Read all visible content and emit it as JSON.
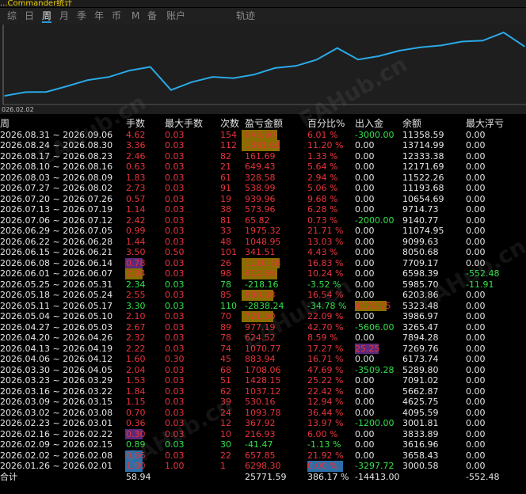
{
  "title_text": "...Commander统计",
  "tabs": [
    "综",
    "日",
    "周",
    "月",
    "季",
    "年",
    "币",
    "M",
    "备",
    "账户",
    "轨迹"
  ],
  "active_tab": "周",
  "chart": {
    "start_label": "026.02.02",
    "line_color": "#2aa9e6",
    "equity": [
      3000.58,
      3616.96,
      3658.43,
      4625.75,
      5662.87,
      6173.74,
      7269.76,
      7894.28,
      3986.97,
      5323.48,
      6203.86,
      5985.7,
      6598.39,
      7709.17,
      8050.68,
      9099.63,
      11074.95,
      9140.77,
      9714.73,
      10654.69,
      11193.68,
      11522.26,
      12171.69,
      12333.38,
      13714.99,
      11358.59
    ]
  },
  "columns": [
    "周",
    "手数",
    "最大手数",
    "次数",
    "盈亏金额",
    "百分比%",
    "出入金",
    "余额",
    "最大浮亏"
  ],
  "rows": [
    {
      "week": "2026.08.31 ~ 2026.09.06",
      "lots": "4.62",
      "maxlots": "0.03",
      "count": "154",
      "pnl": "643.60",
      "pct": "6.01 %",
      "flow": "-3000.00",
      "balance": "11358.59",
      "dd": "0.00",
      "c": "red",
      "fc": "green"
    },
    {
      "week": "2026.08.24 ~ 2026.08.30",
      "lots": "3.36",
      "maxlots": "0.03",
      "count": "112",
      "pnl": "1381.61",
      "pct": "11.20 %",
      "flow": "0.00",
      "balance": "13714.99",
      "dd": "0.00",
      "c": "red",
      "fc": "white"
    },
    {
      "week": "2026.08.17 ~ 2026.08.23",
      "lots": "2.46",
      "maxlots": "0.03",
      "count": "82",
      "pnl": "161.69",
      "pct": "1.33 %",
      "flow": "0.00",
      "balance": "12333.38",
      "dd": "0.00",
      "c": "red",
      "fc": "white"
    },
    {
      "week": "2026.08.10 ~ 2026.08.16",
      "lots": "0.63",
      "maxlots": "0.03",
      "count": "21",
      "pnl": "649.43",
      "pct": "5.64 %",
      "flow": "0.00",
      "balance": "12171.69",
      "dd": "0.00",
      "c": "red",
      "fc": "white"
    },
    {
      "week": "2026.08.03 ~ 2026.08.09",
      "lots": "1.83",
      "maxlots": "0.03",
      "count": "61",
      "pnl": "328.58",
      "pct": "2.94 %",
      "flow": "0.00",
      "balance": "11522.26",
      "dd": "0.00",
      "c": "red",
      "fc": "white"
    },
    {
      "week": "2026.07.27 ~ 2026.08.02",
      "lots": "2.73",
      "maxlots": "0.03",
      "count": "91",
      "pnl": "538.99",
      "pct": "5.06 %",
      "flow": "0.00",
      "balance": "11193.68",
      "dd": "0.00",
      "c": "red",
      "fc": "white"
    },
    {
      "week": "2026.07.20 ~ 2026.07.26",
      "lots": "0.57",
      "maxlots": "0.03",
      "count": "19",
      "pnl": "939.96",
      "pct": "9.68 %",
      "flow": "0.00",
      "balance": "10654.69",
      "dd": "0.00",
      "c": "red",
      "fc": "white"
    },
    {
      "week": "2026.07.13 ~ 2026.07.19",
      "lots": "1.14",
      "maxlots": "0.03",
      "count": "38",
      "pnl": "573.96",
      "pct": "6.28 %",
      "flow": "0.00",
      "balance": "9714.73",
      "dd": "0.00",
      "c": "red",
      "fc": "white"
    },
    {
      "week": "2026.07.06 ~ 2026.07.12",
      "lots": "2.42",
      "maxlots": "0.03",
      "count": "81",
      "pnl": "65.82",
      "pct": "0.73 %",
      "flow": "-2000.00",
      "balance": "9140.77",
      "dd": "0.00",
      "c": "red",
      "fc": "green"
    },
    {
      "week": "2026.06.29 ~ 2026.07.05",
      "lots": "0.99",
      "maxlots": "0.03",
      "count": "33",
      "pnl": "1975.32",
      "pct": "21.71 %",
      "flow": "0.00",
      "balance": "11074.95",
      "dd": "0.00",
      "c": "red",
      "fc": "white"
    },
    {
      "week": "2026.06.22 ~ 2026.06.28",
      "lots": "1.44",
      "maxlots": "0.03",
      "count": "48",
      "pnl": "1048.95",
      "pct": "13.03 %",
      "flow": "0.00",
      "balance": "9099.63",
      "dd": "0.00",
      "c": "red",
      "fc": "white"
    },
    {
      "week": "2026.06.15 ~ 2026.06.21",
      "lots": "3.50",
      "maxlots": "0.50",
      "count": "101",
      "pnl": "341.51",
      "pct": "4.43 %",
      "flow": "0.00",
      "balance": "8050.68",
      "dd": "0.00",
      "c": "red",
      "fc": "white"
    },
    {
      "week": "2026.06.08 ~ 2026.06.14",
      "lots": "0.78",
      "maxlots": "0.03",
      "count": "26",
      "pnl": "1110.78",
      "pct": "16.83 %",
      "flow": "0.00",
      "balance": "7709.17",
      "dd": "0.00",
      "c": "red",
      "fc": "white"
    },
    {
      "week": "2026.06.01 ~ 2026.06.07",
      "lots": "2.94",
      "maxlots": "0.03",
      "count": "98",
      "pnl": "612.69",
      "pct": "10.24 %",
      "flow": "0.00",
      "balance": "6598.39",
      "dd": "-552.48",
      "c": "red",
      "fc": "white",
      "ddc": "green"
    },
    {
      "week": "2026.05.25 ~ 2026.05.31",
      "lots": "2.34",
      "maxlots": "0.03",
      "count": "78",
      "pnl": "-218.16",
      "pct": "-3.52 %",
      "flow": "0.00",
      "balance": "5985.70",
      "dd": "-11.91",
      "c": "green",
      "fc": "white",
      "ddc": "green"
    },
    {
      "week": "2026.05.18 ~ 2026.05.24",
      "lots": "2.55",
      "maxlots": "0.03",
      "count": "85",
      "pnl": "880.38",
      "pct": "16.54 %",
      "flow": "0.00",
      "balance": "6203.86",
      "dd": "0.00",
      "c": "red",
      "fc": "white"
    },
    {
      "week": "2026.05.11 ~ 2026.05.17",
      "lots": "3.30",
      "maxlots": "0.03",
      "count": "110",
      "pnl": "-2838.24",
      "pct": "-34.78 %",
      "flow": "4174.75",
      "balance": "5323.48",
      "dd": "0.00",
      "c": "green",
      "fc": "red"
    },
    {
      "week": "2026.05.04 ~ 2026.05.10",
      "lots": "2.10",
      "maxlots": "0.03",
      "count": "70",
      "pnl": "721.50",
      "pct": "22.09 %",
      "flow": "0.00",
      "balance": "3986.97",
      "dd": "0.00",
      "c": "red",
      "fc": "white"
    },
    {
      "week": "2026.04.27 ~ 2026.05.03",
      "lots": "2.67",
      "maxlots": "0.03",
      "count": "89",
      "pnl": "977.19",
      "pct": "42.70 %",
      "flow": "-5606.00",
      "balance": "3265.47",
      "dd": "0.00",
      "c": "red",
      "fc": "green"
    },
    {
      "week": "2026.04.20 ~ 2026.04.26",
      "lots": "2.32",
      "maxlots": "0.03",
      "count": "78",
      "pnl": "624.52",
      "pct": "8.59 %",
      "flow": "0.00",
      "balance": "7894.28",
      "dd": "0.00",
      "c": "red",
      "fc": "white"
    },
    {
      "week": "2026.04.13 ~ 2026.04.19",
      "lots": "2.22",
      "maxlots": "0.03",
      "count": "74",
      "pnl": "1070.77",
      "pct": "17.27 %",
      "flow": "25.25",
      "balance": "7269.76",
      "dd": "0.00",
      "c": "red",
      "fc": "red"
    },
    {
      "week": "2026.04.06 ~ 2026.04.12",
      "lots": "1.60",
      "maxlots": "0.30",
      "count": "45",
      "pnl": "883.94",
      "pct": "16.71 %",
      "flow": "0.00",
      "balance": "6173.74",
      "dd": "0.00",
      "c": "red",
      "fc": "white"
    },
    {
      "week": "2026.03.30 ~ 2026.04.05",
      "lots": "2.04",
      "maxlots": "0.03",
      "count": "68",
      "pnl": "1708.06",
      "pct": "47.69 %",
      "flow": "-3509.28",
      "balance": "5289.80",
      "dd": "0.00",
      "c": "red",
      "fc": "green"
    },
    {
      "week": "2026.03.23 ~ 2026.03.29",
      "lots": "1.53",
      "maxlots": "0.03",
      "count": "51",
      "pnl": "1428.15",
      "pct": "25.22 %",
      "flow": "0.00",
      "balance": "7091.02",
      "dd": "0.00",
      "c": "red",
      "fc": "white"
    },
    {
      "week": "2026.03.16 ~ 2026.03.22",
      "lots": "1.84",
      "maxlots": "0.03",
      "count": "62",
      "pnl": "1037.12",
      "pct": "22.42 %",
      "flow": "0.00",
      "balance": "5662.87",
      "dd": "0.00",
      "c": "red",
      "fc": "white"
    },
    {
      "week": "2026.03.09 ~ 2026.03.15",
      "lots": "1.15",
      "maxlots": "0.03",
      "count": "39",
      "pnl": "530.16",
      "pct": "12.94 %",
      "flow": "0.00",
      "balance": "4625.75",
      "dd": "0.00",
      "c": "red",
      "fc": "white"
    },
    {
      "week": "2026.03.02 ~ 2026.03.08",
      "lots": "0.70",
      "maxlots": "0.03",
      "count": "24",
      "pnl": "1093.78",
      "pct": "36.44 %",
      "flow": "0.00",
      "balance": "4095.59",
      "dd": "0.00",
      "c": "red",
      "fc": "white"
    },
    {
      "week": "2026.02.23 ~ 2026.03.01",
      "lots": "0.36",
      "maxlots": "0.03",
      "count": "12",
      "pnl": "367.92",
      "pct": "13.97 %",
      "flow": "-1200.00",
      "balance": "3001.81",
      "dd": "0.00",
      "c": "red",
      "fc": "green"
    },
    {
      "week": "2026.02.16 ~ 2026.02.22",
      "lots": "0.30",
      "maxlots": "0.03",
      "count": "10",
      "pnl": "216.93",
      "pct": "6.00 %",
      "flow": "0.00",
      "balance": "3833.89",
      "dd": "0.00",
      "c": "red",
      "fc": "white"
    },
    {
      "week": "2026.02.09 ~ 2026.02.15",
      "lots": "0.89",
      "maxlots": "0.03",
      "count": "30",
      "pnl": "-41.47",
      "pct": "-1.13 %",
      "flow": "0.00",
      "balance": "3616.96",
      "dd": "0.00",
      "c": "green",
      "fc": "white"
    },
    {
      "week": "2026.02.02 ~ 2026.02.08",
      "lots": "0.66",
      "maxlots": "0.03",
      "count": "22",
      "pnl": "657.85",
      "pct": "21.92 %",
      "flow": "0.00",
      "balance": "3658.43",
      "dd": "0.00",
      "c": "red",
      "fc": "white"
    },
    {
      "week": "2026.01.26 ~ 2026.02.01",
      "lots": "1.00",
      "maxlots": "1.00",
      "count": "1",
      "pnl": "6298.30",
      "pct": "0.00 %",
      "flow": "-3297.72",
      "balance": "3000.58",
      "dd": "0.00",
      "c": "red",
      "fc": "green"
    }
  ],
  "total": {
    "label": "合计",
    "lots": "58.94",
    "pnl": "25771.59",
    "pct": "386.17 %",
    "flow": "-14413.00",
    "dd": "-552.48"
  },
  "watermark": "EAHub.cn",
  "colors": {
    "profit": "#e8333b",
    "loss": "#33e04a",
    "tab_active_underline": "#2a9bd6"
  }
}
